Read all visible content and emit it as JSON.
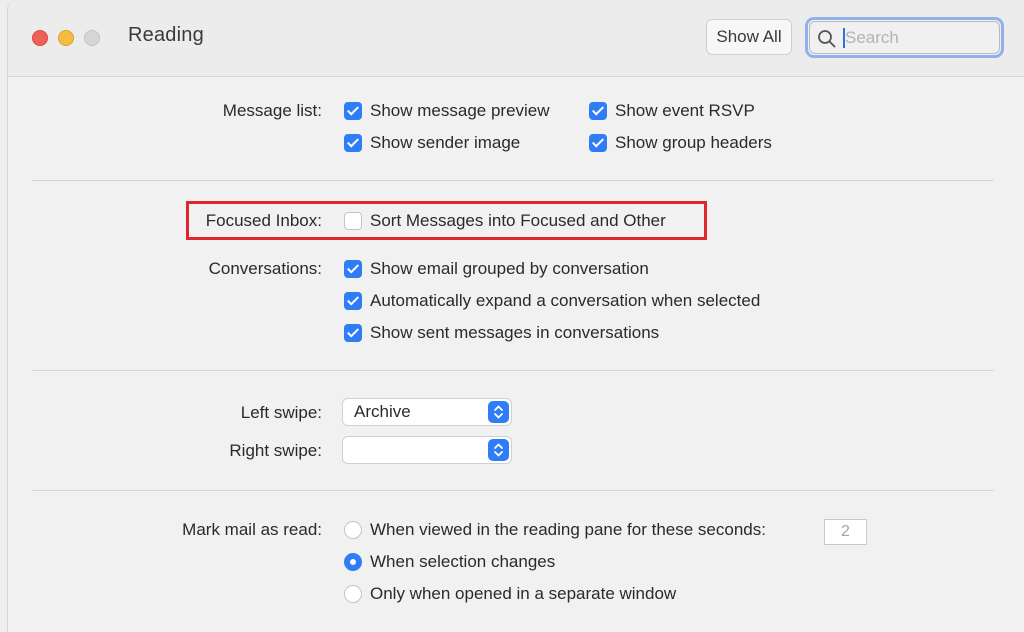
{
  "window": {
    "title": "Reading",
    "show_all_label": "Show All",
    "search_placeholder": "Search"
  },
  "message_list": {
    "label": "Message list:",
    "options": [
      {
        "label": "Show message preview",
        "checked": true
      },
      {
        "label": "Show event RSVP",
        "checked": true
      },
      {
        "label": "Show sender image",
        "checked": true
      },
      {
        "label": "Show group headers",
        "checked": true
      }
    ]
  },
  "focused_inbox": {
    "label": "Focused Inbox:",
    "option": {
      "label": "Sort Messages into Focused and Other",
      "checked": false
    },
    "highlight_color": "#e2262f"
  },
  "conversations": {
    "label": "Conversations:",
    "options": [
      {
        "label": "Show email grouped by conversation",
        "checked": true
      },
      {
        "label": "Automatically expand a conversation when selected",
        "checked": true
      },
      {
        "label": "Show sent messages in conversations",
        "checked": true
      }
    ]
  },
  "swipe": {
    "left_label": "Left swipe:",
    "left_value": "Archive",
    "right_label": "Right swipe:",
    "right_value": ""
  },
  "mark_read": {
    "label": "Mark mail as read:",
    "options": [
      {
        "label": "When viewed in the reading pane for these seconds:",
        "selected": false
      },
      {
        "label": "When selection changes",
        "selected": true
      },
      {
        "label": "Only when opened in a separate window",
        "selected": false
      }
    ],
    "seconds_value": "2"
  },
  "colors": {
    "accent": "#2f7df6",
    "close": "#ee5f57",
    "minimize": "#f5bd3f",
    "zoom": "#d6d6d6"
  }
}
